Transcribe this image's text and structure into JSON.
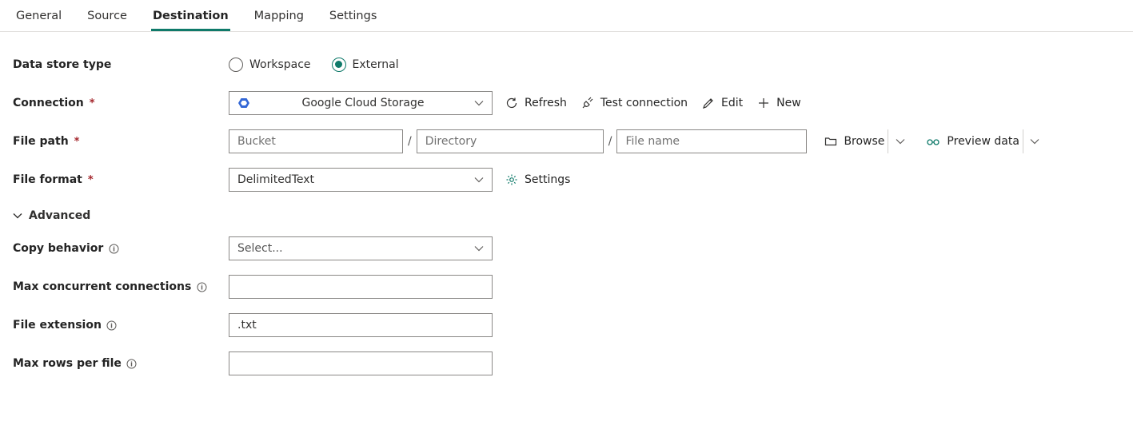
{
  "tabs": {
    "t0": "General",
    "t1": "Source",
    "t2": "Destination",
    "t3": "Mapping",
    "t4": "Settings",
    "activeIndex": 2
  },
  "labels": {
    "datastore": "Data store type",
    "connection": "Connection",
    "filepath": "File path",
    "fileformat": "File format",
    "advanced": "Advanced",
    "copybehavior": "Copy behavior",
    "maxcc": "Max concurrent connections",
    "fileext": "File extension",
    "maxrows": "Max rows per file"
  },
  "datastore": {
    "opt_workspace": "Workspace",
    "opt_external": "External",
    "selected": "external"
  },
  "connection": {
    "value": "Google Cloud Storage"
  },
  "actions": {
    "refresh": "Refresh",
    "test": "Test connection",
    "edit": "Edit",
    "new": "New",
    "browse": "Browse",
    "preview": "Preview data",
    "settings": "Settings"
  },
  "filepath": {
    "bucket_ph": "Bucket",
    "dir_ph": "Directory",
    "file_ph": "File name",
    "bucket_val": "",
    "dir_val": "",
    "file_val": ""
  },
  "fileformat": {
    "value": "DelimitedText"
  },
  "copybehavior": {
    "placeholder": "Select...",
    "value": ""
  },
  "maxcc": {
    "value": ""
  },
  "fileext": {
    "value": ".txt"
  },
  "maxrows": {
    "value": ""
  }
}
